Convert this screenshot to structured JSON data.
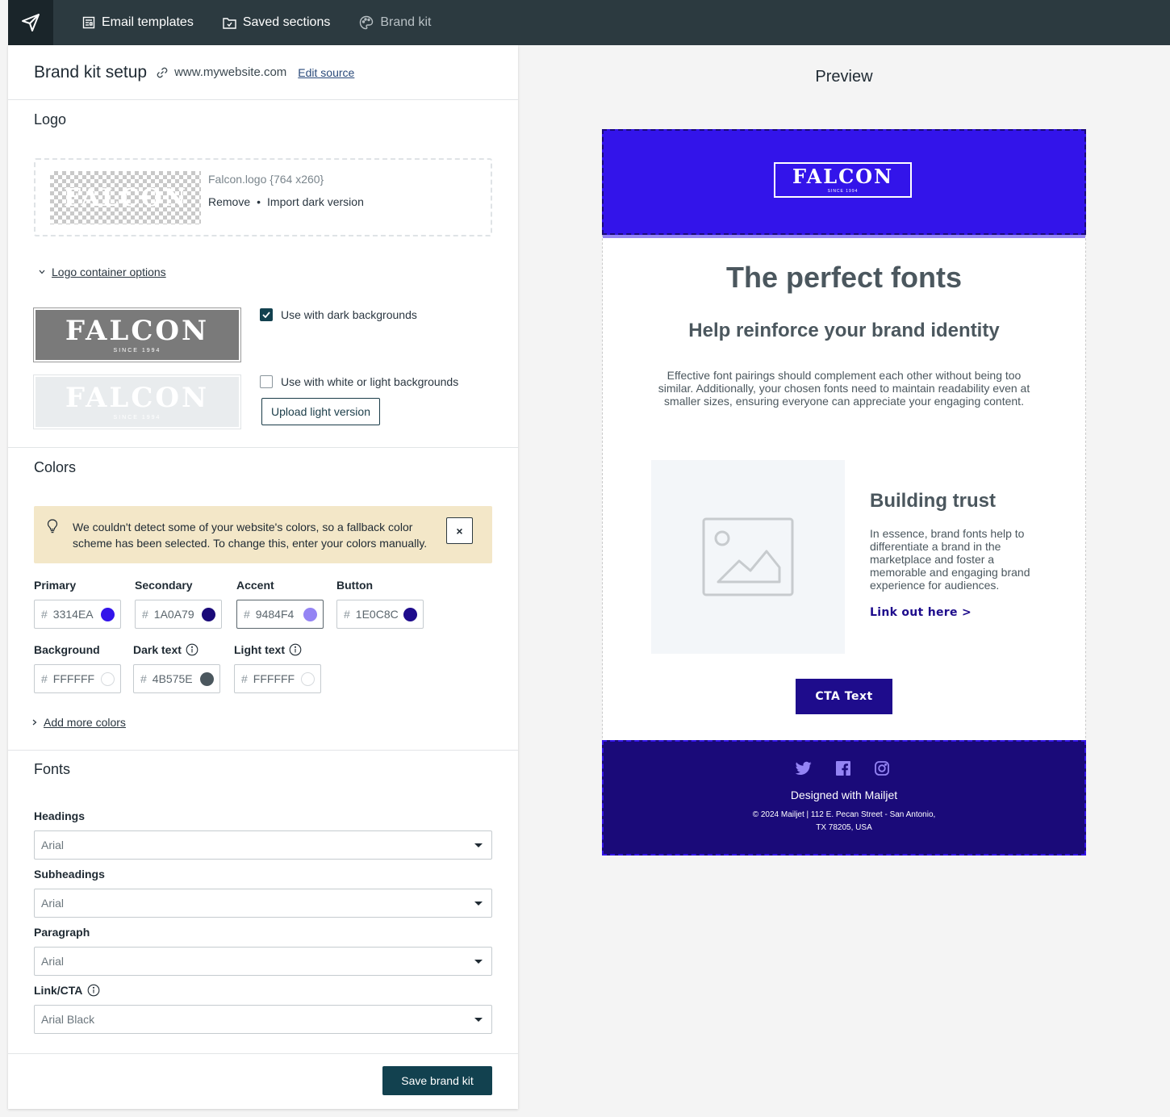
{
  "nav": {
    "items": [
      {
        "label": "Email templates"
      },
      {
        "label": "Saved sections"
      },
      {
        "label": "Brand kit"
      }
    ]
  },
  "panel": {
    "title": "Brand kit setup",
    "website": "www.mywebsite.com",
    "edit_source": "Edit source",
    "logo": {
      "section_title": "Logo",
      "preview_text": "FALCON",
      "file_label": "Falcon.logo {764 x260}",
      "remove": "Remove",
      "separator": "•",
      "import_dark": "Import dark version",
      "container_options": "Logo container options",
      "variant_word": "FALCON",
      "variant_since": "SINCE 1994",
      "dark_label": "Use with dark backgrounds",
      "dark_checked": true,
      "light_label": "Use with white or light backgrounds",
      "light_checked": false,
      "upload_light": "Upload light version"
    },
    "colors": {
      "section_title": "Colors",
      "alert": "We couldn't detect some of your website's colors, so a fallback color scheme has been selected. To change this, enter your colors manually.",
      "alert_close": "×",
      "hash": "#",
      "fields": [
        {
          "label": "Primary",
          "value": "3314EA",
          "color": "#3314EA"
        },
        {
          "label": "Secondary",
          "value": "1A0A79",
          "color": "#1A0A79"
        },
        {
          "label": "Accent",
          "value": "9484F4",
          "color": "#9484F4"
        },
        {
          "label": "Button",
          "value": "1E0C8C",
          "color": "#1E0C8C"
        },
        {
          "label": "Background",
          "value": "FFFFFF",
          "color": "#FFFFFF"
        },
        {
          "label": "Dark text",
          "value": "4B575E",
          "color": "#4B575E"
        },
        {
          "label": "Light text",
          "value": "FFFFFF",
          "color": "#FFFFFF"
        }
      ],
      "add_more": "Add more colors"
    },
    "fonts": {
      "section_title": "Fonts",
      "fields": [
        {
          "label": "Headings",
          "value": "Arial"
        },
        {
          "label": "Subheadings",
          "value": "Arial"
        },
        {
          "label": "Paragraph",
          "value": "Arial"
        },
        {
          "label": "Link/CTA",
          "value": "Arial Black"
        }
      ]
    },
    "save": "Save brand kit"
  },
  "preview": {
    "title": "Preview",
    "logo_word": "FALCON",
    "logo_since": "SINCE 1994",
    "heading": "The perfect fonts",
    "subheading": "Help reinforce your brand identity",
    "paragraph": "Effective font pairings should complement each other without being too similar. Additionally, your chosen fonts need to maintain readability even at smaller sizes, ensuring everyone can appreciate your engaging content.",
    "block_title": "Building trust",
    "block_text": "In essence, brand fonts help to differentiate a brand in the marketplace and foster a memorable and engaging brand experience for audiences.",
    "link_text": "Link out here >",
    "cta": "CTA Text",
    "designed_with": "Designed with Mailjet",
    "address_line1": "© 2024 Mailjet | 112 E. Pecan Street - San Antonio,",
    "address_line2": "TX 78205, USA"
  }
}
